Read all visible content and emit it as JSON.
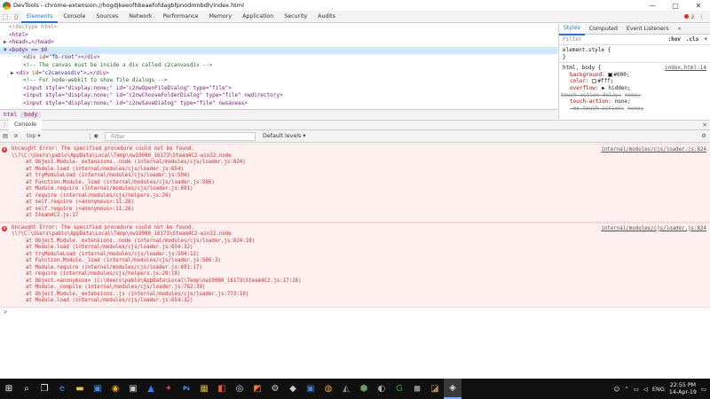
{
  "window": {
    "title": "DevTools - chrome-extension://hogdjkeeofhbeaefofdagbfpnodmnbdh/index.html",
    "minimize_icon": "minimize-icon",
    "maximize_icon": "maximize-icon",
    "close_icon": "close-icon"
  },
  "devtools_tabs": [
    "Elements",
    "Console",
    "Sources",
    "Network",
    "Performance",
    "Memory",
    "Application",
    "Security",
    "Audits"
  ],
  "active_tab": "Elements",
  "error_count": "2",
  "elements_lines": [
    {
      "indent": 0,
      "text": "<!doctype html>",
      "kind": "doctype"
    },
    {
      "indent": 0,
      "text": "<html>",
      "kind": "tag"
    },
    {
      "indent": 0,
      "text": "<head>…</head>",
      "kind": "tag",
      "tri": "▶"
    },
    {
      "indent": 0,
      "text": "<body> == $0",
      "kind": "tag",
      "tri": "▼",
      "selected": true
    },
    {
      "indent": 2,
      "tag_open": "<div ",
      "attr": "id",
      "val": "\"fb-root\"",
      "tag_close": "></div>",
      "kind": "attrtag"
    },
    {
      "indent": 2,
      "text": "<!-- The canvas must be inside a div called c2canvasdiv -->",
      "kind": "comment"
    },
    {
      "indent": 1,
      "tag_open": "<div ",
      "attr": "id",
      "val": "\"c2canvasdiv\"",
      "tag_close": ">…</div>",
      "kind": "attrtag",
      "tri": "▶"
    },
    {
      "indent": 2,
      "text": "<!-- For node-webkit to show file dialogs -->",
      "kind": "comment"
    },
    {
      "indent": 2,
      "text": "<input style=\"display:none;\" id=\"c2nwOpenFileDialog\" type=\"file\">",
      "kind": "tag"
    },
    {
      "indent": 2,
      "text": "<input style=\"display:none;\" id=\"c2nwChooseFolderDialog\" type=\"file\" nwdirectory>",
      "kind": "tag"
    },
    {
      "indent": 2,
      "text": "<input style=\"display:none;\" id=\"c2nwSaveDialog\" type=\"file\" nwsaveas>",
      "kind": "tag"
    }
  ],
  "breadcrumbs": [
    "html",
    "body"
  ],
  "styles": {
    "tabs": [
      "Styles",
      "Computed",
      "Event Listeners",
      "»"
    ],
    "filter_placeholder": "Filter",
    "hov": ":hov",
    "cls": ".cls",
    "add": "+",
    "element_style": "element.style {",
    "element_style_close": "}",
    "rule_selector": "html, body {",
    "rule_source": "index.html:14",
    "props": [
      {
        "name": "background:",
        "value": "#000;",
        "swatch": "#000000"
      },
      {
        "name": "color:",
        "value": "#fff;",
        "swatch": "#ffffff"
      },
      {
        "name": "overflow:",
        "value": "▶ hidden;"
      },
      {
        "name": "touch-action-delay:",
        "value": "none;",
        "struck": true,
        "warn": true
      },
      {
        "name": "touch-action:",
        "value": "none;"
      },
      {
        "name": "-ms-touch-action:",
        "value": "none;",
        "struck": true
      }
    ]
  },
  "drawer": {
    "tab": "Console",
    "context": "top",
    "filter_placeholder": "Filter",
    "levels": "Default levels ▾"
  },
  "errors": [
    {
      "source": "internal/modules/cjs/loader.js:824",
      "lines": [
        "Uncaught Error: The specified procedure could not be found.",
        "\\\\?\\C:\\Users\\pablo\\AppData\\Local\\Temp\\nw19980_16173\\Steam4C2-win32.node",
        "at Object.Module._extensions..node (internal/modules/cjs/loader.js:824)",
        "at Module.load (internal/modules/cjs/loader.js:654)",
        "at tryModuleLoad (internal/modules/cjs/loader.js:594)",
        "at Function.Module._load (internal/modules/cjs/loader.js:586)",
        "at Module.require (internal/modules/cjs/loader.js:691)",
        "at require (internal/modules/cjs/helpers.js:20)",
        "at self.require (<anonymous>:11:26)",
        "at self.require (<anonymous>:11:26)",
        "at Steam4C2.js:17"
      ]
    },
    {
      "source": "internal/modules/cjs/loader.js:824",
      "lines": [
        "Uncaught Error: The specified procedure could not be found.",
        "\\\\?\\C:\\Users\\pablo\\AppData\\Local\\Temp\\nw19980_16173\\Steam4C2-win32.node",
        "at Object.Module._extensions..node (internal/modules/cjs/loader.js:824:18)",
        "at Module.load (internal/modules/cjs/loader.js:654:32)",
        "at tryModuleLoad (internal/modules/cjs/loader.js:594:12)",
        "at Function.Module._load (internal/modules/cjs/loader.js:586:3)",
        "at Module.require (internal/modules/cjs/loader.js:691:17)",
        "at require (internal/modules/cjs/helpers.js:20:18)",
        "at Object.<anonymous> (C:\\Users\\pablo\\AppData\\Local\\Temp\\nw19980_16173\\Steam4C2.js:17:16)",
        "at Module._compile (internal/modules/cjs/loader.js:762:30)",
        "at Object.Module._extensions..js (internal/modules/cjs/loader.js:773:10)",
        "at Module.load (internal/modules/cjs/loader.js:654:32)"
      ]
    }
  ],
  "prompt": ">",
  "taskbar": {
    "lang": "ENG",
    "time": "22:55 PM",
    "date": "14-Apr-19",
    "apps": [
      {
        "name": "windows-start-icon",
        "glyph": "⊞",
        "color": "#ffffff"
      },
      {
        "name": "search-icon",
        "glyph": "⌕",
        "color": "#ffffff"
      },
      {
        "name": "task-view-icon",
        "glyph": "❐",
        "color": "#ffffff"
      },
      {
        "name": "edge-icon",
        "glyph": "e",
        "color": "#3b8ee8"
      },
      {
        "name": "folder-icon",
        "glyph": "▬",
        "color": "#f0c040"
      },
      {
        "name": "store-icon",
        "glyph": "▣",
        "color": "#3b8ee8"
      },
      {
        "name": "chrome-icon",
        "glyph": "◉",
        "color": "#e8a820"
      },
      {
        "name": "terminal-icon",
        "glyph": "▣",
        "color": "#cccccc"
      },
      {
        "name": "app-icon",
        "glyph": "▲",
        "color": "#2f7de0"
      },
      {
        "name": "construct-icon",
        "glyph": "✦",
        "color": "#d04040"
      },
      {
        "name": "photoshop-icon",
        "glyph": "Ps",
        "color": "#31a8ff"
      },
      {
        "name": "file-manager-icon",
        "glyph": "▦",
        "color": "#e0b040"
      },
      {
        "name": "bag-icon",
        "glyph": "◧",
        "color": "#e06030"
      },
      {
        "name": "steam-icon",
        "glyph": "◎",
        "color": "#c8d8f0"
      },
      {
        "name": "app-icon-2",
        "glyph": "◩",
        "color": "#f08030"
      },
      {
        "name": "settings-icon",
        "glyph": "⚙",
        "color": "#cccccc"
      },
      {
        "name": "controller-icon",
        "glyph": "◆",
        "color": "#cccccc"
      },
      {
        "name": "game-icon",
        "glyph": "▣",
        "color": "#4080e0"
      },
      {
        "name": "blender-icon",
        "glyph": "◍",
        "color": "#f0a030"
      },
      {
        "name": "app-icon-3",
        "glyph": "◭",
        "color": "#888888"
      },
      {
        "name": "app-icon-4",
        "glyph": "⬢",
        "color": "#60a060"
      },
      {
        "name": "app-icon-5",
        "glyph": "◐",
        "color": "#aaaaaa"
      },
      {
        "name": "green-app-icon",
        "glyph": "G",
        "color": "#30a050"
      },
      {
        "name": "app-icon-6",
        "glyph": "◼",
        "color": "#888888"
      },
      {
        "name": "app-icon-7",
        "glyph": "◪",
        "color": "#aa8855"
      },
      {
        "name": "devtools-icon",
        "glyph": "◈",
        "color": "#dddddd"
      }
    ]
  }
}
